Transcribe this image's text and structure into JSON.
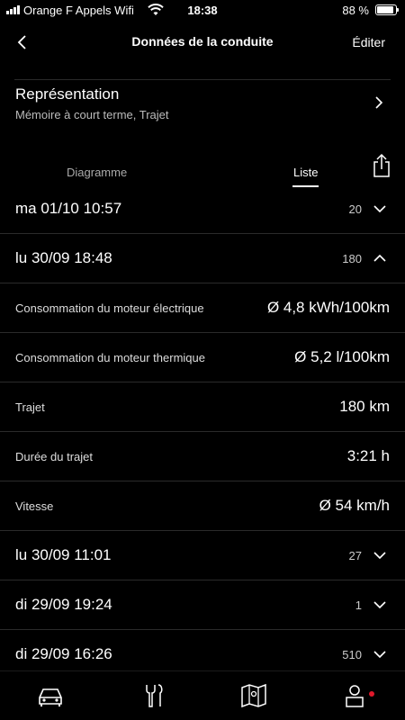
{
  "status": {
    "carrier": "Orange F Appels Wifi",
    "time": "18:38",
    "battery": "88 %",
    "battery_level": 0.88
  },
  "nav": {
    "title": "Données de la conduite",
    "edit_label": "Éditer",
    "back_icon": "chevron-left-icon"
  },
  "representation": {
    "title": "Représentation",
    "subtitle": "Mémoire à court terme, Trajet"
  },
  "tabs": {
    "diagram": "Diagramme",
    "list": "Liste",
    "active": "list"
  },
  "trips": [
    {
      "date": "ma 01/10 10:57",
      "distance": "20",
      "expanded": false
    },
    {
      "date": "lu 30/09 18:48",
      "distance": "180",
      "expanded": true,
      "details": [
        {
          "label": "Consommation du moteur électrique",
          "value": "Ø 4,8 kWh/100km"
        },
        {
          "label": "Consommation du moteur thermique",
          "value": "Ø 5,2 l/100km"
        },
        {
          "label": "Trajet",
          "value": "180 km"
        },
        {
          "label": "Durée du trajet",
          "value": "3:21 h"
        },
        {
          "label": "Vitesse",
          "value": "Ø 54 km/h"
        }
      ]
    },
    {
      "date": "lu 30/09 11:01",
      "distance": "27",
      "expanded": false
    },
    {
      "date": "di 29/09 19:24",
      "distance": "1",
      "expanded": false
    },
    {
      "date": "di 29/09 16:26",
      "distance": "510",
      "expanded": false
    }
  ],
  "tab_bar": {
    "items": [
      "car-icon",
      "tools-icon",
      "map-icon",
      "profile-icon"
    ],
    "notification_color": "#e0192b"
  }
}
